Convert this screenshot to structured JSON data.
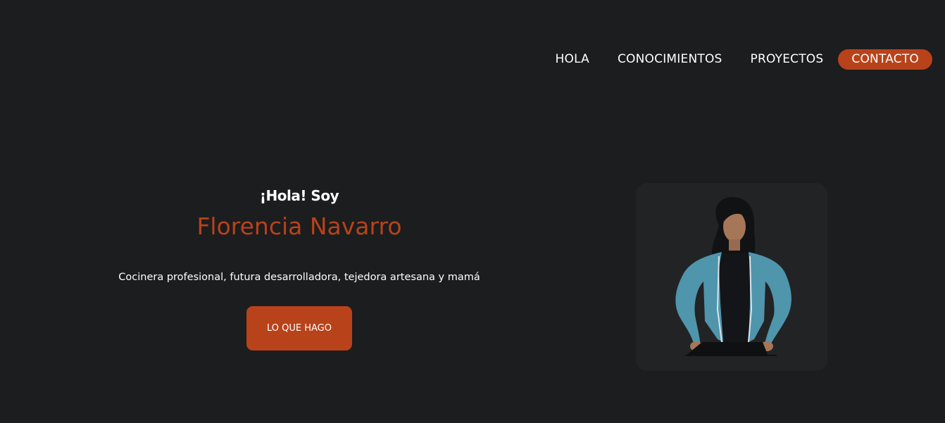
{
  "nav": {
    "items": [
      {
        "label": "HOLA"
      },
      {
        "label": "CONOCIMIENTOS"
      },
      {
        "label": "PROYECTOS"
      },
      {
        "label": "CONTACTO"
      }
    ]
  },
  "hero": {
    "greeting": "¡Hola! Soy",
    "name": "Florencia Navarro",
    "description": "Cocinera profesional, futura desarrolladora, tejedora artesana y mamá",
    "cta_label": "LO QUE HAGO"
  },
  "colors": {
    "background": "#1c1d1f",
    "accent": "#b8421a",
    "text": "#ffffff",
    "card": "#222325"
  }
}
